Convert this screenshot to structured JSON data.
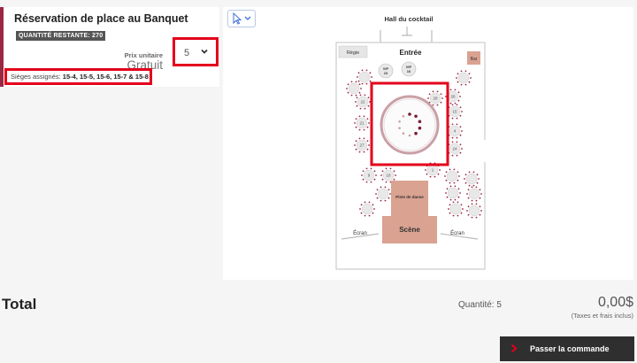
{
  "ticket": {
    "title": "Réservation de place au Banquet",
    "remaining_label": "QUANTITÉ RESTANTE:",
    "remaining_value": "270",
    "price_label": "Prix unitaire",
    "price_value": "Gratuit",
    "quantity_selected": "5",
    "assigned_label": "Sièges assignés:",
    "assigned_value": "15-4, 15-5, 15-6, 15-7 & 15-8"
  },
  "map": {
    "hall_label": "Hall du cocktail",
    "entrance_label": "Entrée",
    "regie_label": "Régie",
    "bar_label": "Bar",
    "dance_floor_label": "Piste de danse",
    "stage_label": "Scène",
    "screen_left_label": "Écran",
    "screen_right_label": "Écran",
    "vip_tables": [
      {
        "label": "VIP",
        "number": "23"
      },
      {
        "label": "VIP",
        "number": "16"
      }
    ],
    "table_numbers": [
      "22",
      "21",
      "27",
      "28",
      "26",
      "15",
      "4",
      "24",
      "9",
      "18",
      "1"
    ]
  },
  "summary": {
    "total_label": "Total",
    "quantity_text": "Quantité: 5",
    "amount": "0,00$",
    "taxes_note": "(Taxes et frais inclus)",
    "checkout_label": "Passer la commande"
  },
  "colors": {
    "accent": "#9b2743",
    "highlight": "#e3001b",
    "stage": "#d9a291",
    "dark_button": "#2f2f2f"
  },
  "icons": {
    "pointer": "pointer-icon",
    "dropdown": "chevron-down-icon",
    "checkout_arrow": "chevron-right-icon"
  }
}
